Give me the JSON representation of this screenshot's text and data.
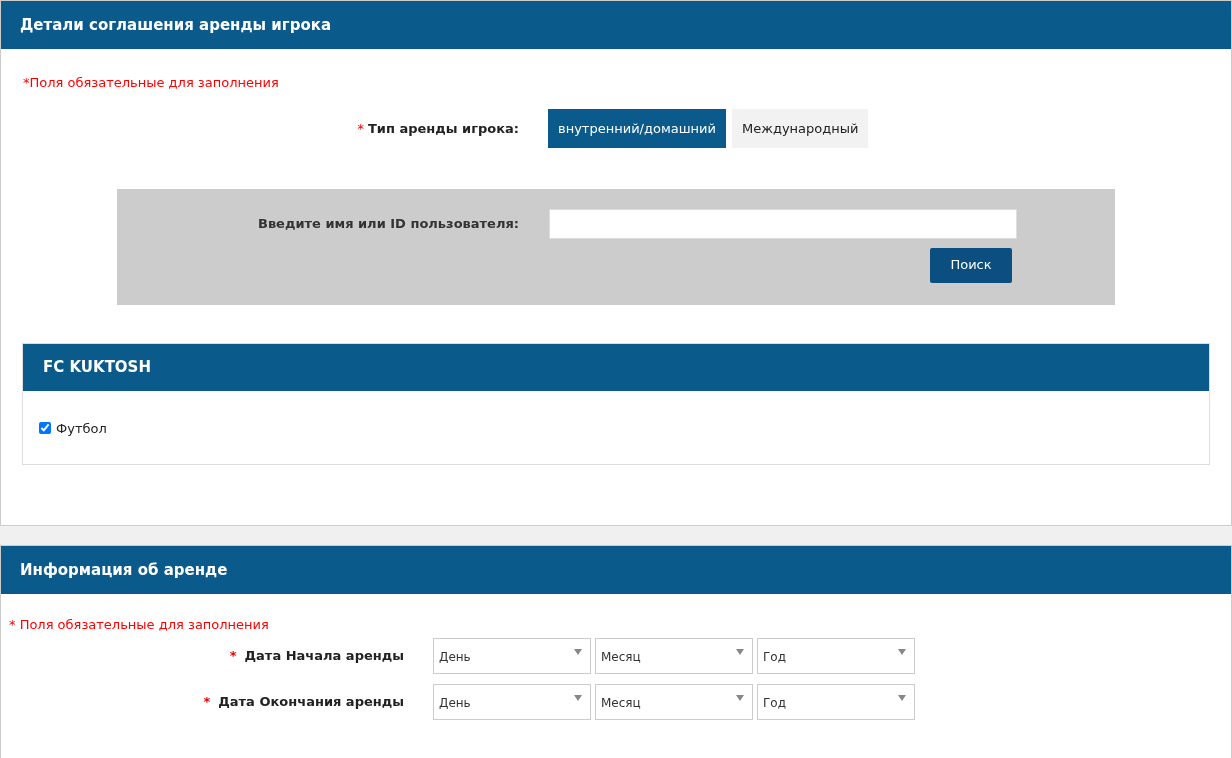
{
  "agreement": {
    "title": "Детали соглашения аренды игрока",
    "required_note": "*Поля обязательные для заполнения",
    "loan_type": {
      "marker": "*",
      "label": "Тип аренды игрока:",
      "options": [
        {
          "label": "внутренний/домашний",
          "selected": true
        },
        {
          "label": "Международный",
          "selected": false
        }
      ]
    },
    "search": {
      "label": "Введите имя или ID пользователя:",
      "button": "Поиск"
    },
    "club": {
      "title": "FC KUKTOSH",
      "sports": [
        {
          "label": "Футбол",
          "checked": true
        }
      ]
    }
  },
  "loan_info": {
    "title": "Информация об аренде",
    "required_note": "* Поля обязательные для заполнения",
    "rows": [
      {
        "marker": "*",
        "label": "Дата Начала аренды",
        "selects": [
          "День",
          "Месяц",
          "Год"
        ]
      },
      {
        "marker": "*",
        "label": "Дата Окончания аренды",
        "selects": [
          "День",
          "Месяц",
          "Год"
        ]
      }
    ]
  }
}
